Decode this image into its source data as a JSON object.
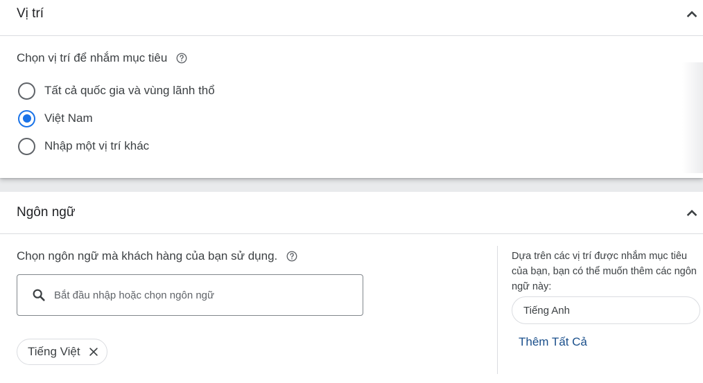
{
  "location": {
    "title": "Vị trí",
    "prompt": "Chọn vị trí để nhắm mục tiêu",
    "options": [
      {
        "label": "Tất cả quốc gia và vùng lãnh thổ",
        "selected": false
      },
      {
        "label": "Việt Nam",
        "selected": true
      },
      {
        "label": "Nhập một vị trí khác",
        "selected": false
      }
    ]
  },
  "language": {
    "title": "Ngôn ngữ",
    "prompt": "Chọn ngôn ngữ mà khách hàng của bạn sử dụng.",
    "search_placeholder": "Bắt đầu nhập hoặc chọn ngôn ngữ",
    "search_value": "",
    "selected_chip": "Tiếng Việt",
    "suggestion_text": "Dựa trên các vị trí được nhắm mục tiêu của bạn, bạn có thể muốn thêm các ngôn ngữ này:",
    "suggested_language": "Tiếng Anh",
    "add_all_label": "Thêm Tất Cả"
  },
  "icons": {
    "collapse": "chevron-up-icon",
    "help": "help-circle-icon",
    "search": "search-icon",
    "remove": "close-icon"
  },
  "colors": {
    "accent": "#1a73e8",
    "link": "#1a4f8b",
    "border": "#dadce0",
    "text": "#3c4043"
  }
}
